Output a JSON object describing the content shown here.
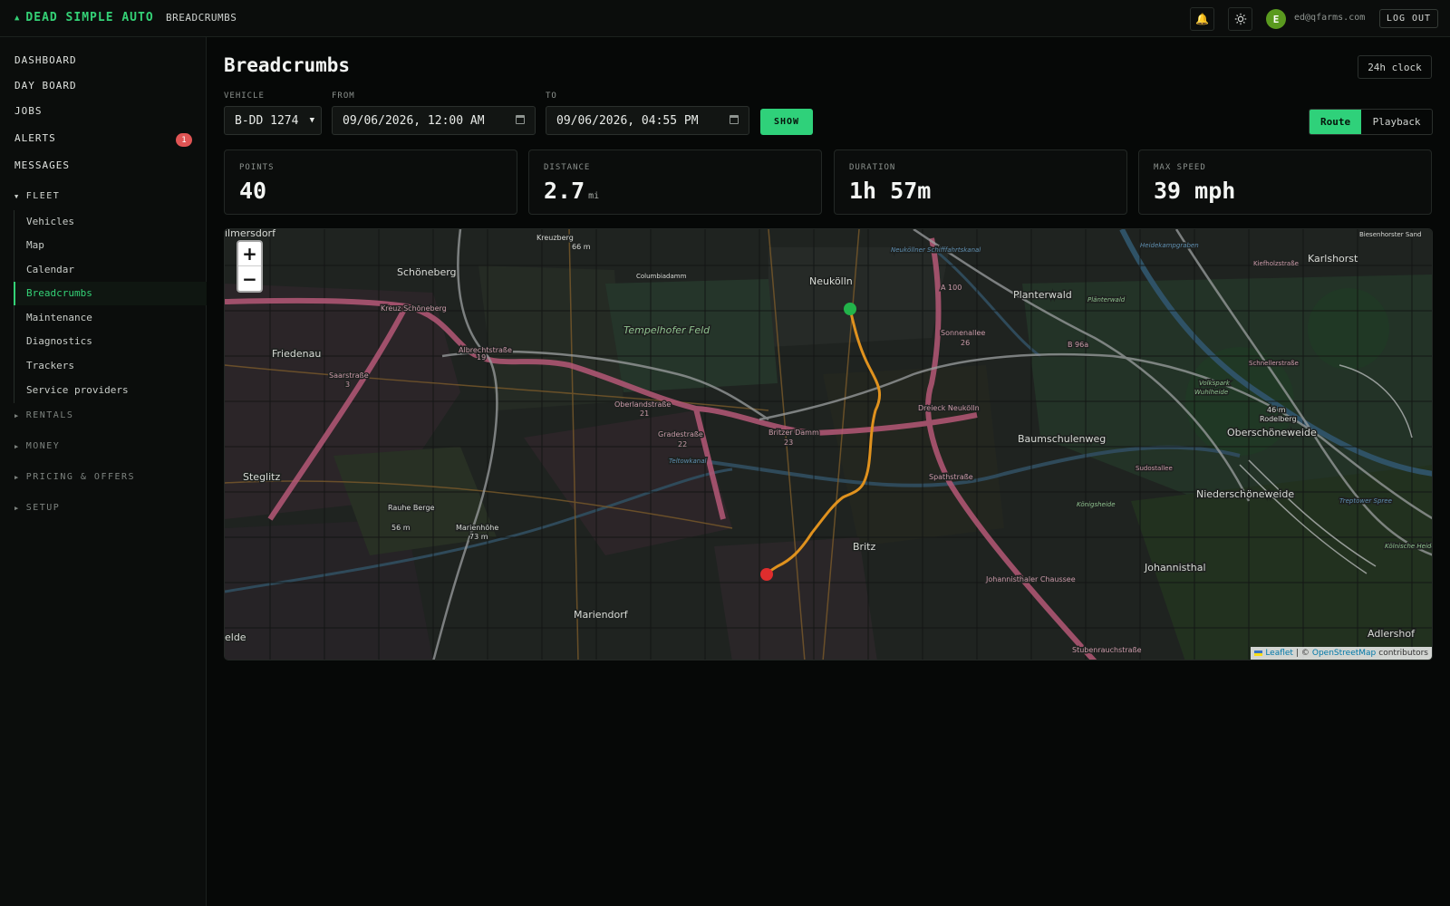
{
  "header": {
    "brand": "DEAD SIMPLE AUTO",
    "breadcrumb": "BREADCRUMBS",
    "user_initial": "E",
    "user_email": "ed@qfarms.com",
    "logout_label": "LOG OUT"
  },
  "sidebar": {
    "top_items": [
      {
        "label": "DASHBOARD"
      },
      {
        "label": "DAY BOARD"
      },
      {
        "label": "JOBS"
      },
      {
        "label": "ALERTS",
        "badge": "1"
      },
      {
        "label": "MESSAGES"
      }
    ],
    "fleet": {
      "label": "FLEET",
      "items": [
        "Vehicles",
        "Map",
        "Calendar",
        "Breadcrumbs",
        "Maintenance",
        "Diagnostics",
        "Trackers",
        "Service providers"
      ],
      "active": "Breadcrumbs"
    },
    "sections": [
      "RENTALS",
      "MONEY",
      "PRICING & OFFERS",
      "SETUP"
    ]
  },
  "main": {
    "title": "Breadcrumbs",
    "clock_button": "24h clock",
    "filters": {
      "vehicle_label": "VEHICLE",
      "vehicle_value": "B-DD 1274",
      "from_label": "FROM",
      "from_value": "09/06/2026, 12:00 AM",
      "to_label": "TO",
      "to_value": "09/06/2026, 04:55 PM",
      "show_label": "SHOW"
    },
    "view_toggle": {
      "options": [
        "Route",
        "Playback"
      ],
      "selected": "Route"
    },
    "stats": [
      {
        "label": "POINTS",
        "value": "40",
        "unit": ""
      },
      {
        "label": "DISTANCE",
        "value": "2.7",
        "unit": "mi"
      },
      {
        "label": "DURATION",
        "value": "1h 57m",
        "unit": ""
      },
      {
        "label": "MAX SPEED",
        "value": "39 mph",
        "unit": ""
      }
    ]
  },
  "map": {
    "zoom_in": "+",
    "zoom_out": "−",
    "attribution": {
      "leaflet": "Leaflet",
      "sep": "| ©",
      "osm": "OpenStreetMap",
      "suffix": "contributors"
    },
    "places": [
      "ilmersdorf",
      "Kreuzberg",
      "66 m",
      "Schöneberg",
      "Columbiadamm",
      "Neukölln",
      "A 100",
      "Planterwald",
      "Plänterwald",
      "Karlshorst",
      "Biesenhorster Sand",
      "Tempelhofer Feld",
      "Sonnenallee",
      "26",
      "B 96a",
      "Friedenau",
      "Kreuz Schöneberg",
      "Albrechtstraße",
      "19",
      "Saarstraße",
      "3",
      "Oberlandstraße",
      "21",
      "Gradestraße",
      "22",
      "Britzer Damm",
      "23",
      "Dreieck Neukölln",
      "Baumschulenweg",
      "Oberschöneweide",
      "Rodelberg",
      "46 m",
      "Wuhlheide",
      "Volkspark",
      "Steglitz",
      "Rauhe Berge",
      "56 m",
      "Marienhöhe",
      "73 m",
      "Teltowkanal",
      "Spathstraße",
      "Königsheide",
      "Niederschöneweide",
      "Britz",
      "Johannisthal",
      "Johannisthaler Chaussee",
      "Mariendorf",
      "Adlershof",
      "Stubenrauchstraße",
      "elde",
      "Kölnische Heide",
      "Treptower Spree",
      "Sudostallee",
      "Schnellerstraße",
      "Kiefholzstraße",
      "Heidekampgraben",
      "Neuköllner Schifffahrtskanal"
    ]
  },
  "colors": {
    "accent": "#2fd17a",
    "alert_badge": "#e05454",
    "route": "#e0921e",
    "route_start": "#22b34a",
    "route_end": "#e02d2d"
  }
}
